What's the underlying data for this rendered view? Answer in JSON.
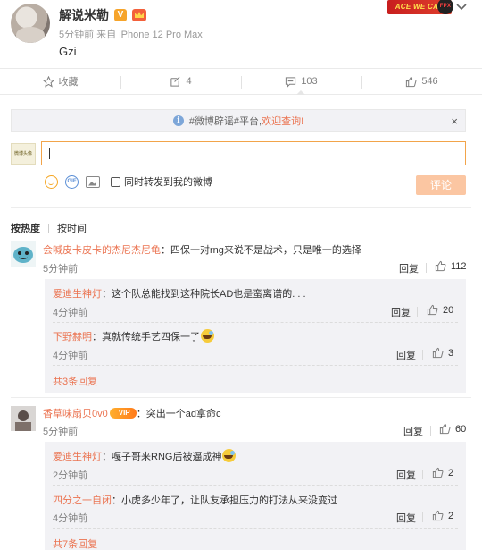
{
  "post": {
    "author": "解说米勒",
    "badge_v": "V",
    "meta": "5分钟前 来自 iPhone 12 Pro Max",
    "text": "Gzi",
    "team_logo_text": "ACE WE CAN"
  },
  "actions": [
    {
      "label": "收藏",
      "icon": "star-icon"
    },
    {
      "label": "4",
      "icon": "repost-icon"
    },
    {
      "label": "103",
      "icon": "comment-icon"
    },
    {
      "label": "546",
      "icon": "thumbs-up-icon"
    }
  ],
  "notice": {
    "prefix": "#微博辟谣#平台,",
    "highlight": "欢迎查询!",
    "close": "×"
  },
  "composer": {
    "avatar_text": "微博头像",
    "input_value": "",
    "repost_label": "同时转发到我的微博",
    "submit_label": "评论"
  },
  "sort": {
    "hot": "按热度",
    "time": "按时间"
  },
  "comments": [
    {
      "name": "会喊皮卡皮卡的杰尼杰尼龟",
      "text": "：四保一对rng来说不是战术，只是唯一的选择",
      "time": "5分钟前",
      "reply": "回复",
      "likes": "112",
      "replies": [
        {
          "name": "爱迪生神灯",
          "text": "：这个队总能找到这种院长AD也是蛮离谱的. . .",
          "time": "4分钟前",
          "reply": "回复",
          "likes": "20"
        },
        {
          "name": "下野赫明",
          "text": "：真就传统手艺四保一了",
          "time": "4分钟前",
          "reply": "回复",
          "likes": "3",
          "emoji": true
        }
      ],
      "more": "共3条回复"
    },
    {
      "name": "香草味扇贝0v0",
      "text": "：突出一个ad拿命c",
      "time": "5分钟前",
      "reply": "回复",
      "likes": "60",
      "replies": [
        {
          "name": "爱迪生神灯",
          "text": "：嘎子哥来RNG后被逼成神",
          "time": "2分钟前",
          "reply": "回复",
          "likes": "2",
          "emoji": true
        },
        {
          "name": "四分之一自闭",
          "text": "：小虎多少年了，让队友承担压力的打法从来没变过",
          "time": "4分钟前",
          "reply": "回复",
          "likes": "2"
        }
      ],
      "more": "共7条回复"
    }
  ],
  "colors": {
    "accent": "#eb7350",
    "input_border": "#f2a44a",
    "submit_bg": "#fbc6a2",
    "sub_bg": "#f2f2f5"
  }
}
